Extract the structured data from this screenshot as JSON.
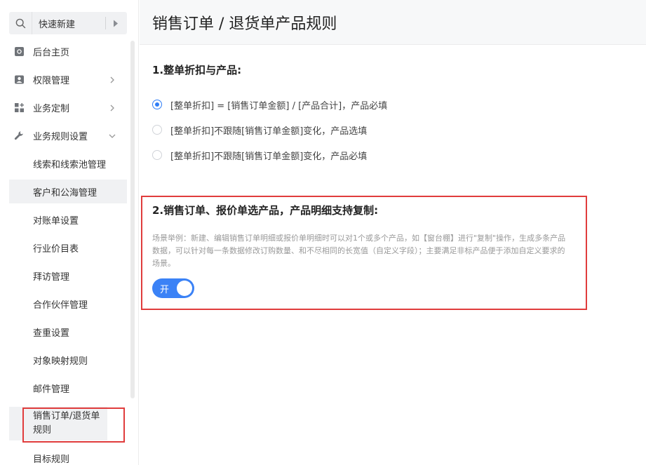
{
  "sidebar": {
    "quick_create": "快速新建",
    "menu": [
      {
        "label": "后台主页",
        "icon": "home-icon"
      },
      {
        "label": "权限管理",
        "icon": "user-card-icon"
      },
      {
        "label": "业务定制",
        "icon": "grid-plus-icon"
      },
      {
        "label": "业务规则设置",
        "icon": "wrench-icon"
      }
    ],
    "sub_items": [
      "线索和线索池管理",
      "客户和公海管理",
      "对账单设置",
      "行业价目表",
      "拜访管理",
      "合作伙伴管理",
      "查重设置",
      "对象映射规则",
      "邮件管理",
      "销售订单/退货单规则",
      "目标规则"
    ]
  },
  "main": {
    "title": "销售订单 / 退货单产品规则",
    "section1": {
      "title": "1.整单折扣与产品:",
      "options": [
        {
          "label": "[整单折扣] = [销售订单金额] / [产品合计]，产品必填",
          "checked": true
        },
        {
          "label": "[整单折扣]不跟随[销售订单金额]变化，产品选填",
          "checked": false
        },
        {
          "label": "[整单折扣]不跟随[销售订单金额]变化，产品必填",
          "checked": false
        }
      ]
    },
    "section2": {
      "title": "2.销售订单、报价单选产品，产品明细支持复制:",
      "description": "场景举例：新建、编辑销售订单明细或报价单明细时可以对1个或多个产品，如【窗台棚】进行\"复制\"操作，生成多条产品数据，可以针对每一条数据修改订购数量、和不尽相同的长宽值（自定义字段）；主要满足非标产品便于添加自定义要求的场景。",
      "toggle_label": "开"
    }
  },
  "colors": {
    "accent": "#2f7df6",
    "highlight_border": "#e03c3c"
  }
}
